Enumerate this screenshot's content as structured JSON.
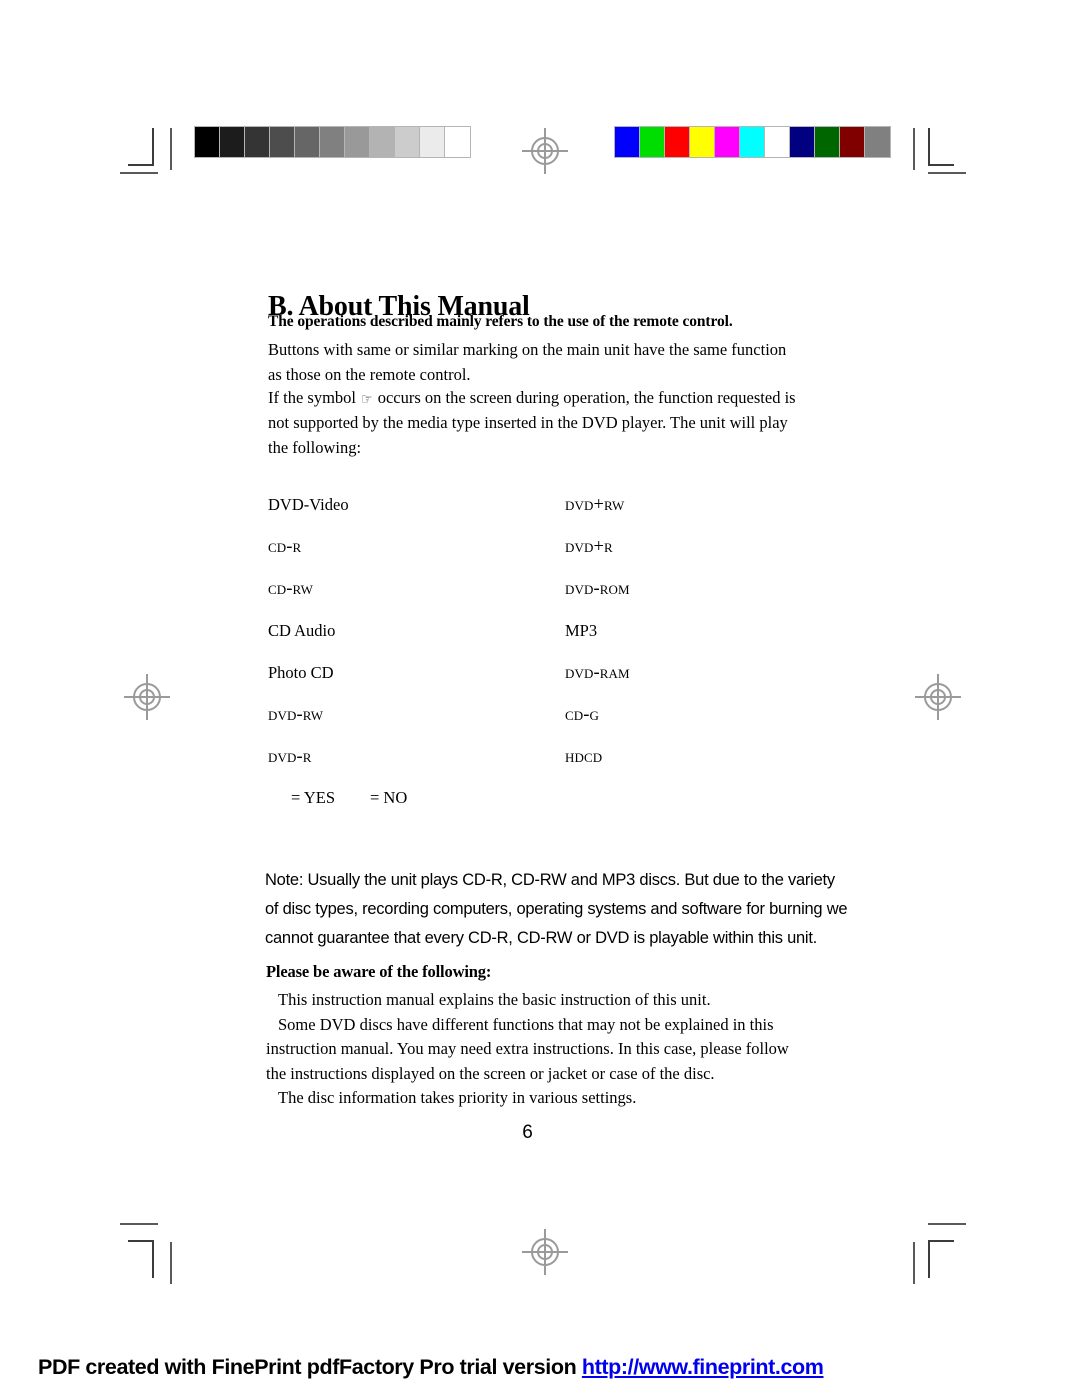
{
  "calibration": {
    "grayscale_label": "grayscale-calibration-strip",
    "grayscale_swatches": [
      "#000000",
      "#1c1c1c",
      "#343434",
      "#4d4d4d",
      "#666666",
      "#808080",
      "#999999",
      "#b3b3b3",
      "#cccccc",
      "#ebebeb",
      "#ffffff"
    ],
    "color_label": "color-calibration-strip",
    "color_swatches": [
      "#0000ff",
      "#00dd00",
      "#fe0000",
      "#ffff00",
      "#ff00ff",
      "#00ffff",
      "#ffffff",
      "#000080",
      "#006600",
      "#800000",
      "#808080"
    ]
  },
  "document": {
    "heading": "B. About This Manual",
    "lead_bold": "The operations described mainly  refers to the use of the remote control.",
    "para_buttons": "Buttons with same or similar marking on the main unit have the same function as those on the remote control.",
    "para_symbol_before": "If the symbol",
    "symbol_glyph": "☞",
    "para_symbol_after": "occurs on the screen during operation, the function requested is not supported by the media type inserted in the DVD player.  The unit will play the following:",
    "disc_rows": [
      {
        "left": "DVD-Video",
        "left_caps": false,
        "right": "DVD+RW",
        "right_caps": true
      },
      {
        "left": "CD-R",
        "left_caps": true,
        "right": "DVD+R",
        "right_caps": true
      },
      {
        "left": "CD-RW",
        "left_caps": true,
        "right": "DVD-ROM",
        "right_caps": true
      },
      {
        "left": "CD Audio",
        "left_caps": false,
        "right": "MP3",
        "right_caps": false
      },
      {
        "left": "Photo CD",
        "left_caps": false,
        "right": "DVD-RAM",
        "right_caps": true
      },
      {
        "left": "DVD-RW",
        "left_caps": true,
        "right": "CD-G",
        "right_caps": true
      },
      {
        "left": "DVD-R",
        "left_caps": true,
        "right": "HDCD",
        "right_caps": true
      }
    ],
    "legend_yes": "= YES",
    "legend_no": "= NO",
    "note": "Note: Usually the unit plays CD-R, CD-RW and MP3 discs. But due to the variety of disc types, recording computers, operating systems and software for burning  we cannot guarantee that every CD-R, CD-RW or DVD is playable within this unit.",
    "aware_heading": "Please be aware of the following:",
    "aware_p1": "This instruction manual explains the basic instruction of this unit.",
    "aware_p2": "Some DVD discs have different functions that may not be explained in this instruction manual. You may need extra instructions. In this case, please follow the instructions displayed on the screen or jacket or case of the disc.",
    "aware_p3": "The disc information takes priority in various settings.",
    "page_number": "6"
  },
  "footer": {
    "text": "PDF created with FinePrint pdfFactory Pro trial version ",
    "url": "http://www.fineprint.com",
    "url_color": "#0000ee"
  }
}
